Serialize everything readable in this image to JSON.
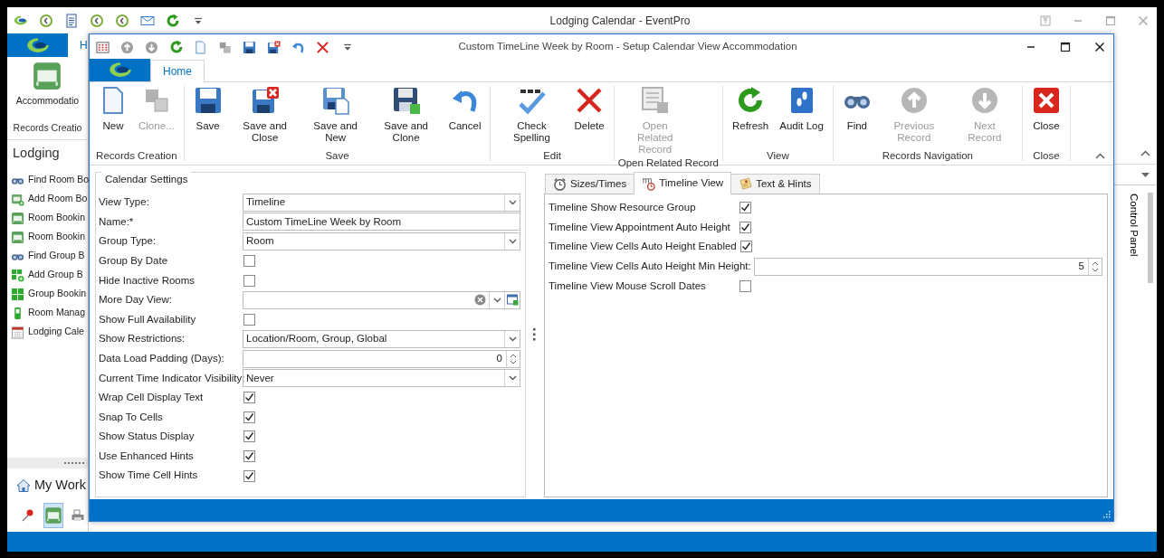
{
  "app_window": {
    "title": "Lodging Calendar - EventPro",
    "tab": "H",
    "ribbon_button": "Accommodatio",
    "ribbon_group": "Records Creatio",
    "panel_title": "Lodging",
    "nav_items": [
      {
        "label": "Find Room Bo"
      },
      {
        "label": "Add Room Bo"
      },
      {
        "label": "Room Bookin"
      },
      {
        "label": "Room Bookin"
      },
      {
        "label": "Find Group B"
      },
      {
        "label": "Add Group B"
      },
      {
        "label": "Group Bookin"
      },
      {
        "label": "Room Manag"
      },
      {
        "label": "Lodging Cale"
      }
    ],
    "workspace_title": "My Work",
    "side_panel": "Control Panel"
  },
  "dialog": {
    "title": "Custom TimeLine Week by Room - Setup Calendar View Accommodation",
    "ribbon_tabs": [
      {
        "label": "Home",
        "selected": true
      }
    ],
    "ribbon_groups": [
      {
        "caption": "Records Creation",
        "buttons": [
          {
            "label": "New",
            "disabled": false
          },
          {
            "label": "Clone...",
            "disabled": true
          }
        ]
      },
      {
        "caption": "Save",
        "buttons": [
          {
            "label": "Save",
            "disabled": false
          },
          {
            "label": "Save and Close",
            "disabled": false
          },
          {
            "label": "Save and New",
            "disabled": false
          },
          {
            "label": "Save and Clone",
            "disabled": false
          },
          {
            "label": "Cancel",
            "disabled": false
          }
        ]
      },
      {
        "caption": "Edit",
        "buttons": [
          {
            "label": "Check Spelling",
            "disabled": false
          },
          {
            "label": "Delete",
            "disabled": false
          }
        ]
      },
      {
        "caption": "Open Related Record",
        "buttons": [
          {
            "label": "Open Related Record",
            "disabled": true
          }
        ]
      },
      {
        "caption": "View",
        "buttons": [
          {
            "label": "Refresh",
            "disabled": false
          },
          {
            "label": "Audit Log",
            "disabled": false
          }
        ]
      },
      {
        "caption": "Records Navigation",
        "buttons": [
          {
            "label": "Find",
            "disabled": false
          },
          {
            "label": "Previous Record",
            "disabled": true
          },
          {
            "label": "Next Record",
            "disabled": true
          }
        ]
      },
      {
        "caption": "Close",
        "buttons": [
          {
            "label": "Close",
            "disabled": false
          }
        ]
      }
    ]
  },
  "calendar_settings": {
    "title": "Calendar Settings",
    "fields": [
      {
        "label": "View Type:",
        "kind": "select",
        "value": "Timeline"
      },
      {
        "label": "Name:*",
        "kind": "text",
        "value": "Custom TimeLine Week by Room"
      },
      {
        "label": "Group Type:",
        "kind": "select",
        "value": "Room"
      },
      {
        "label": "Group By Date",
        "kind": "checkbox",
        "checked": false
      },
      {
        "label": "Hide Inactive Rooms",
        "kind": "checkbox",
        "checked": false
      },
      {
        "label": "More Day View:",
        "kind": "lookup"
      },
      {
        "label": "Show Full Availability",
        "kind": "checkbox",
        "checked": false
      },
      {
        "label": "Show Restrictions:",
        "kind": "select",
        "value": "Location/Room, Group, Global"
      },
      {
        "label": "Data Load Padding (Days):",
        "kind": "spin",
        "value": "0"
      },
      {
        "label": "Current Time Indicator Visibility:",
        "kind": "select",
        "value": "Never"
      },
      {
        "label": "Wrap Cell Display Text",
        "kind": "checkbox",
        "checked": true
      },
      {
        "label": "Snap To Cells",
        "kind": "checkbox",
        "checked": true
      },
      {
        "label": "Show Status Display",
        "kind": "checkbox",
        "checked": true
      },
      {
        "label": "Use Enhanced Hints",
        "kind": "checkbox",
        "checked": true
      },
      {
        "label": "Show Time Cell Hints",
        "kind": "checkbox",
        "checked": true
      }
    ]
  },
  "tabs": [
    {
      "label": "Sizes/Times",
      "selected": false
    },
    {
      "label": "Timeline View",
      "selected": true
    },
    {
      "label": "Text & Hints",
      "selected": false
    }
  ],
  "timeline_view": {
    "fields": [
      {
        "label": "Timeline Show Resource Group",
        "kind": "checkbox",
        "checked": true
      },
      {
        "label": "Timeline View Appointment Auto Height",
        "kind": "checkbox",
        "checked": true
      },
      {
        "label": "Timeline View Cells Auto Height Enabled",
        "kind": "checkbox",
        "checked": true
      },
      {
        "label": "Timeline View Cells Auto Height Min Height:",
        "kind": "spin",
        "value": "5"
      },
      {
        "label": "Timeline View Mouse Scroll Dates",
        "kind": "checkbox",
        "checked": false
      }
    ]
  }
}
